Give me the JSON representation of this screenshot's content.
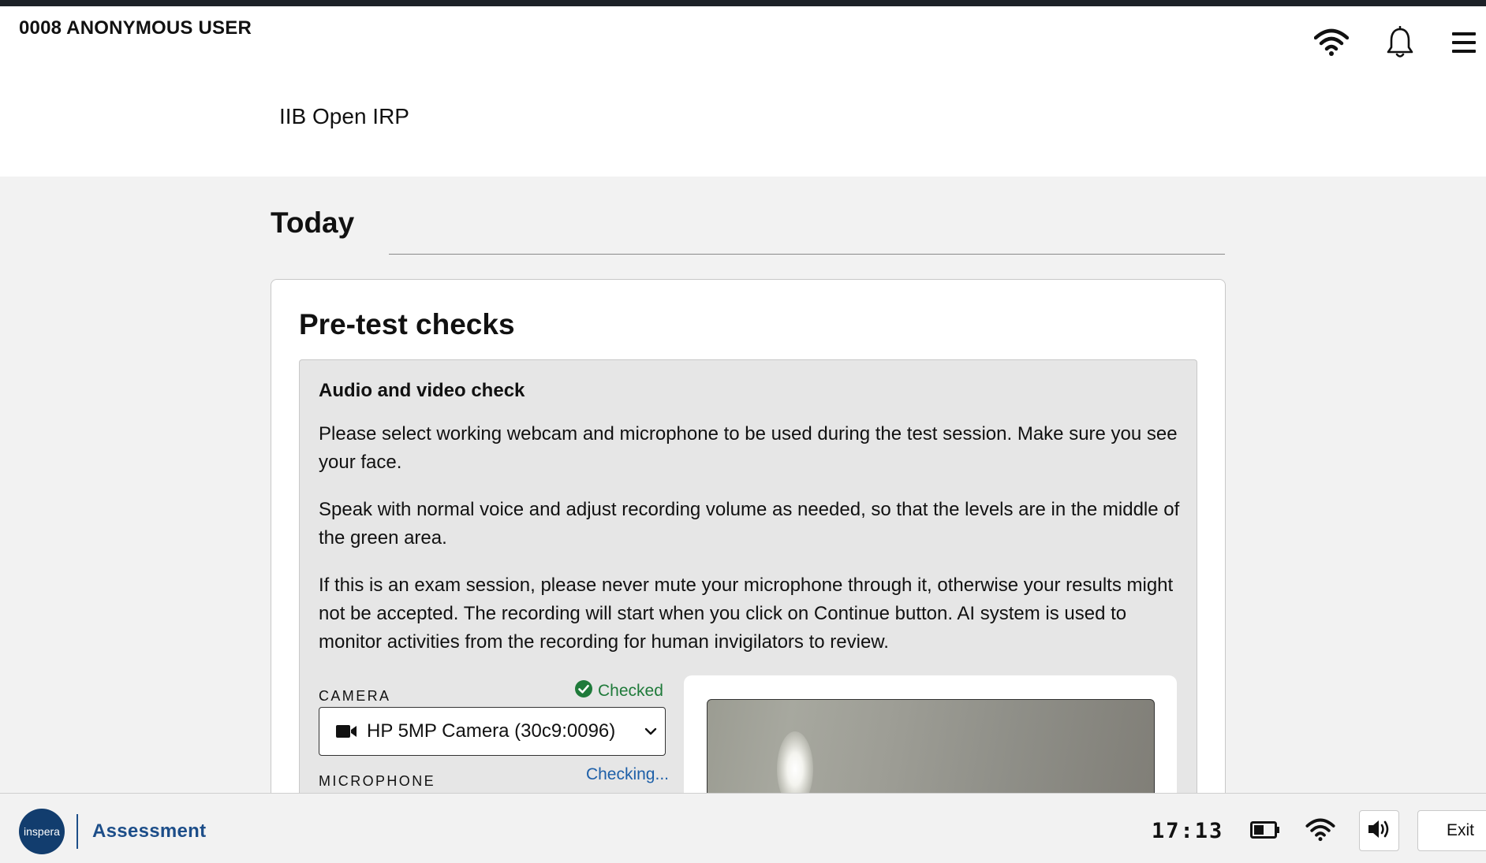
{
  "header": {
    "user_name": "0008 ANONYMOUS USER",
    "course_title": "IIB Open IRP",
    "icons": [
      "wifi-icon",
      "bell-icon",
      "hamburger-menu-icon"
    ]
  },
  "main": {
    "section_title": "Today",
    "card": {
      "title": "Pre-test checks",
      "panel": {
        "title": "Audio and video check",
        "paragraphs": [
          "Please select working webcam and microphone to be used during the test session. Make sure you see your face.",
          "Speak with normal voice and adjust recording volume as needed, so that the levels are in the middle of the green area.",
          "If this is an exam session, please never mute your microphone through it, otherwise your results might not be accepted. The recording will start when you click on Continue button. AI system is used to monitor activities from the recording for human invigilators to review."
        ],
        "camera": {
          "label": "CAMERA",
          "status": "Checked",
          "status_color": "#1f7a3a",
          "selected": "HP 5MP Camera (30c9:0096)"
        },
        "microphone": {
          "label": "MICROPHONE",
          "status": "Checking...",
          "status_color": "#1d5fa8"
        }
      }
    }
  },
  "bottombar": {
    "logo_text": "inspera",
    "brand": "Assessment",
    "brand_color": "#1d4e89",
    "clock": "17:13",
    "exit_label": "Exit",
    "icons": [
      "battery-icon",
      "wifi-icon",
      "speaker-icon"
    ]
  }
}
